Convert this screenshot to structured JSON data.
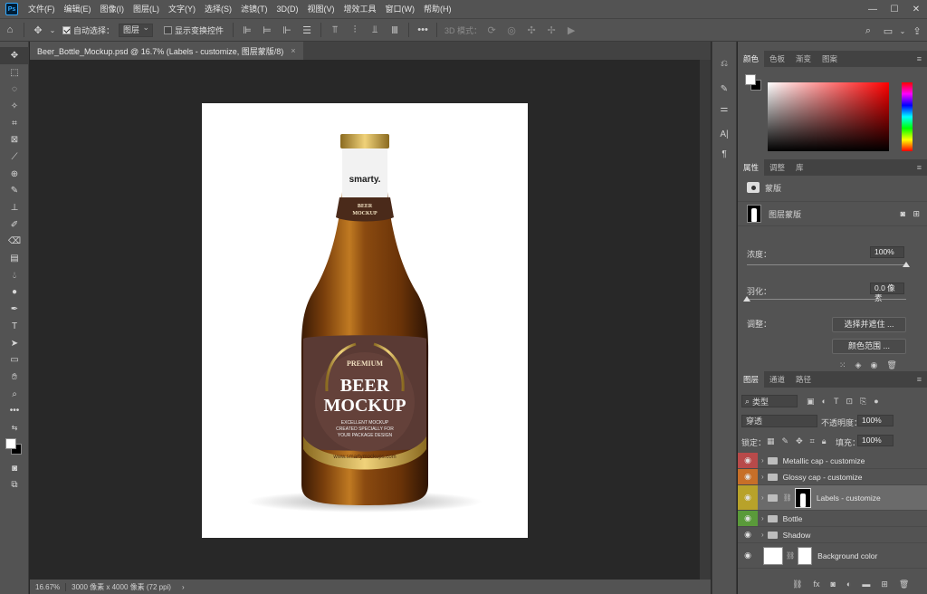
{
  "app": {
    "logo": "Ps"
  },
  "menu": [
    "文件(F)",
    "编辑(E)",
    "图像(I)",
    "图层(L)",
    "文字(Y)",
    "选择(S)",
    "滤镜(T)",
    "3D(D)",
    "视图(V)",
    "增效工具",
    "窗口(W)",
    "帮助(H)"
  ],
  "window_controls": {
    "minimize": "—",
    "maximize": "☐",
    "close": "✕"
  },
  "options": {
    "auto_select_label": "自动选择：",
    "auto_select_target": "图层",
    "show_transform_label": "显示变换控件",
    "more": "•••",
    "mode_3d_label": "3D 模式："
  },
  "document_tab": {
    "title": "Beer_Bottle_Mockup.psd @ 16.7% (Labels - customize, 图层蒙版/8)",
    "close": "×"
  },
  "bottle": {
    "neck_brand": "smarty.",
    "neck_label_line1": "BEER",
    "neck_label_line2": "MOCKUP",
    "label_premium": "PREMIUM",
    "label_title1": "BEER",
    "label_title2": "MOCKUP",
    "label_sub1": "EXCELLENT MOCKUP",
    "label_sub2": "CREATED SPECIALLY FOR",
    "label_sub3": "YOUR PACKAGE DESIGN",
    "label_url": "www.smartymockups.com"
  },
  "status": {
    "zoom": "16.67%",
    "doc_info": "3000 像素 x 4000 像素 (72 ppi)",
    "arrow": "›"
  },
  "color_panel": {
    "tabs": [
      "颜色",
      "色板",
      "渐变",
      "图案"
    ],
    "fg": "#ffffff",
    "bg": "#000000"
  },
  "properties_panel": {
    "tabs": [
      "属性",
      "调整",
      "库"
    ],
    "mask_header": "蒙版",
    "layer_mask_label": "图层蒙版",
    "density_label": "浓度：",
    "density_value": "100%",
    "density_fraction": 1.0,
    "feather_label": "羽化：",
    "feather_value": "0.0 像素",
    "feather_fraction": 0.0,
    "refine_label": "调整：",
    "select_mask_button": "选择并遮住 ...",
    "color_range_button": "颜色范围 ..."
  },
  "layers_panel": {
    "tabs": [
      "图层",
      "通道",
      "路径"
    ],
    "filter_kind": "类型",
    "blend_mode": "穿透",
    "opacity_label": "不透明度：",
    "opacity_value": "100%",
    "lock_label": "锁定：",
    "fill_label": "填充：",
    "fill_value": "100%",
    "layers": [
      {
        "name": "Metallic cap - customize",
        "color": "#b84a4a",
        "type": "group"
      },
      {
        "name": "Glossy cap - customize",
        "color": "#c76f28",
        "type": "group"
      },
      {
        "name": "Labels - customize",
        "color": "#b8a22a",
        "type": "group-mask",
        "selected": true
      },
      {
        "name": "Bottle",
        "color": "#5a9a3a",
        "type": "group"
      },
      {
        "name": "Shadow",
        "color": "#535353",
        "type": "group"
      },
      {
        "name": "Background color",
        "color": "#535353",
        "type": "fill"
      }
    ],
    "footer_icons": [
      "link-icon",
      "fx-icon",
      "mask-icon",
      "adjustment-icon",
      "folder-icon",
      "new-layer-icon",
      "trash-icon"
    ]
  }
}
